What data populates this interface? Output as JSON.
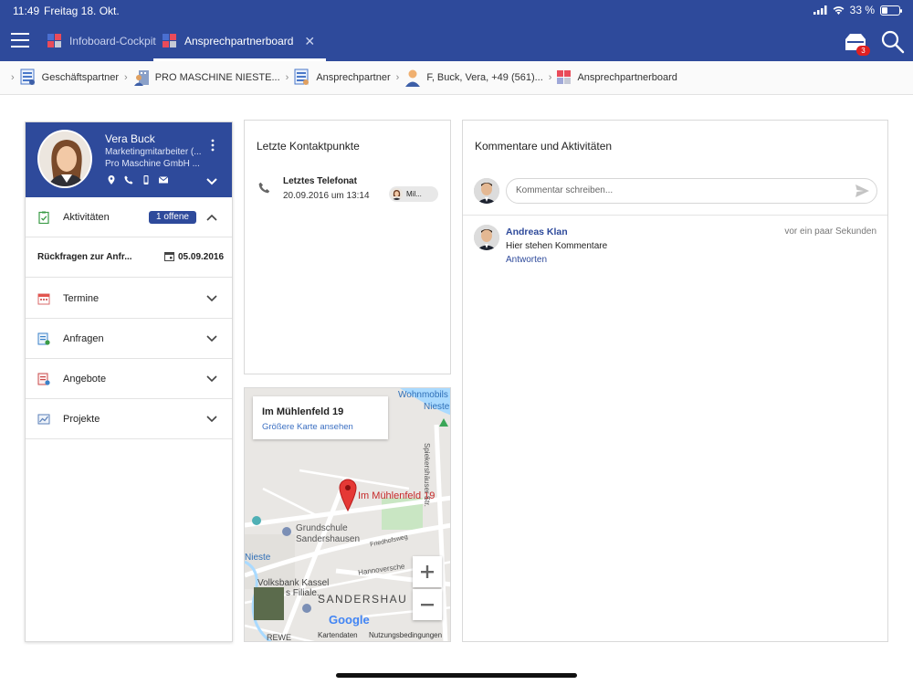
{
  "status": {
    "time": "11:49",
    "date": "Freitag 18. Okt.",
    "battery": "33 %",
    "battery_level": 0.33
  },
  "tabs": [
    {
      "label": "Infoboard-Cockpit",
      "active": false
    },
    {
      "label": "Ansprechpartnerboard",
      "active": true
    }
  ],
  "inbox": {
    "badge": "3"
  },
  "breadcrumb": [
    {
      "label": "Geschäftspartner"
    },
    {
      "label": "PRO MASCHINE NIESTE..."
    },
    {
      "label": "Ansprechpartner"
    },
    {
      "label": "F, Buck, Vera, +49 (561)..."
    },
    {
      "label": "Ansprechpartnerboard"
    }
  ],
  "contact": {
    "name": "Vera Buck",
    "role": "Marketingmitarbeiter (...",
    "company": "Pro Maschine GmbH ...",
    "sections": [
      {
        "label": "Aktivitäten",
        "badge": "1 offene",
        "expanded": true
      },
      {
        "label": "Termine"
      },
      {
        "label": "Anfragen"
      },
      {
        "label": "Angebote"
      },
      {
        "label": "Projekte"
      }
    ],
    "activity": {
      "title": "Rückfragen zur Anfr...",
      "date": "05.09.2016"
    }
  },
  "touchpoints": {
    "title": "Letzte Kontaktpunkte",
    "item": {
      "type": "Letztes Telefonat",
      "date": "20.09.2016 um 13:14",
      "chip": "Mil..."
    }
  },
  "map": {
    "address": "Im Mühlenfeld 19",
    "larger_link": "Größere Karte ansehen",
    "pin_label": "Im Mühlenfeld 19",
    "labels": {
      "wohnmobil": "Wohnmobils",
      "nieste_top": "Nieste",
      "school": "Grundschule",
      "school2": "Sandershausen",
      "street1": "Spiekershäuser Str.",
      "street2": "Friedhofsweg",
      "street3": "Hannoversche",
      "nieste_left": "Nieste",
      "bank": "Volksbank Kassel",
      "bank2": "s Filiale...",
      "town": "SANDERSHAU",
      "rewe": "REWE",
      "google": "Google",
      "mapdata": "Kartendaten",
      "terms": "Nutzungsbedingungen"
    }
  },
  "comments": {
    "title": "Kommentare und Aktivitäten",
    "placeholder": "Kommentar schreiben...",
    "items": [
      {
        "author": "Andreas Klan",
        "time": "vor ein paar Sekunden",
        "text": "Hier stehen Kommentare",
        "reply": "Antworten"
      }
    ]
  },
  "colors": {
    "brand": "#2e4a9b",
    "badge": "#e02020",
    "link": "#3b6fc2"
  }
}
